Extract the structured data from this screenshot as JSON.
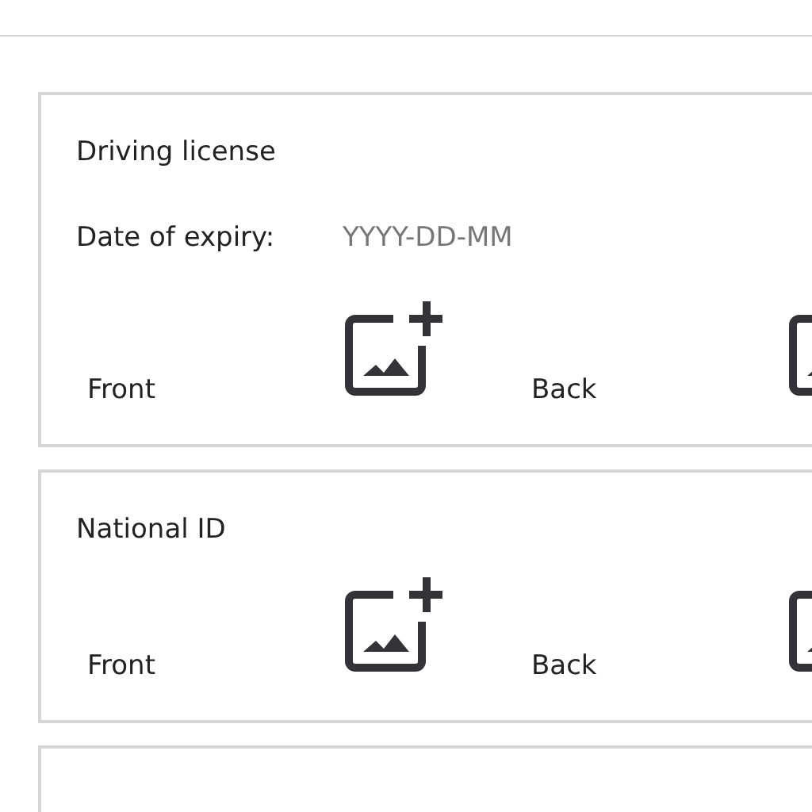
{
  "cards": [
    {
      "title": "Driving license",
      "expiry": {
        "label": "Date of expiry:",
        "placeholder": "YYYY-DD-MM"
      },
      "sides": [
        {
          "label": "Front"
        },
        {
          "label": "Back"
        }
      ]
    },
    {
      "title": "National ID",
      "sides": [
        {
          "label": "Front"
        },
        {
          "label": "Back"
        }
      ]
    }
  ]
}
